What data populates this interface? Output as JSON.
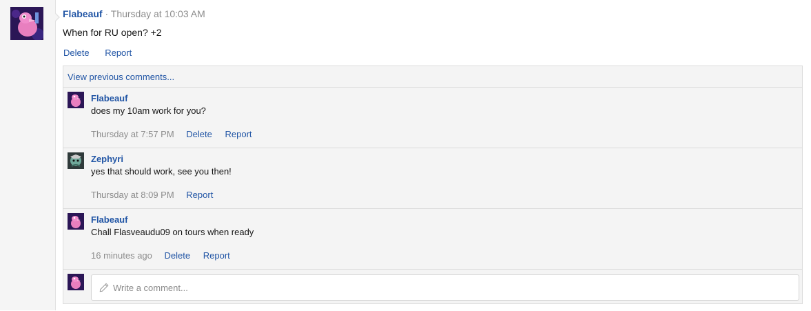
{
  "post": {
    "author": "Flabeauf",
    "meta": "· Thursday at 10:03 AM",
    "text": "When for RU open? +2",
    "actions": [
      "Delete",
      "Report"
    ]
  },
  "comments": {
    "view_previous": "View previous comments...",
    "items": [
      {
        "author": "Flabeauf",
        "avatar": "pink-bird-avatar",
        "text": "does my 10am work for you?",
        "time": "Thursday at 7:57 PM",
        "actions": [
          "Delete",
          "Report"
        ]
      },
      {
        "author": "Zephyri",
        "avatar": "teal-character-avatar",
        "text": "yes that should work, see you then!",
        "time": "Thursday at 8:09 PM",
        "actions": [
          "Report"
        ]
      },
      {
        "author": "Flabeauf",
        "avatar": "pink-bird-avatar",
        "text": "Chall Flasveaudu09 on tours when ready",
        "time": "16 minutes ago",
        "actions": [
          "Delete",
          "Report"
        ]
      }
    ],
    "compose_placeholder": "Write a comment..."
  },
  "colors": {
    "link": "#2155a5",
    "muted": "#8c8c8c",
    "panel_bg": "#f4f4f4",
    "border": "#dcdcdc"
  }
}
